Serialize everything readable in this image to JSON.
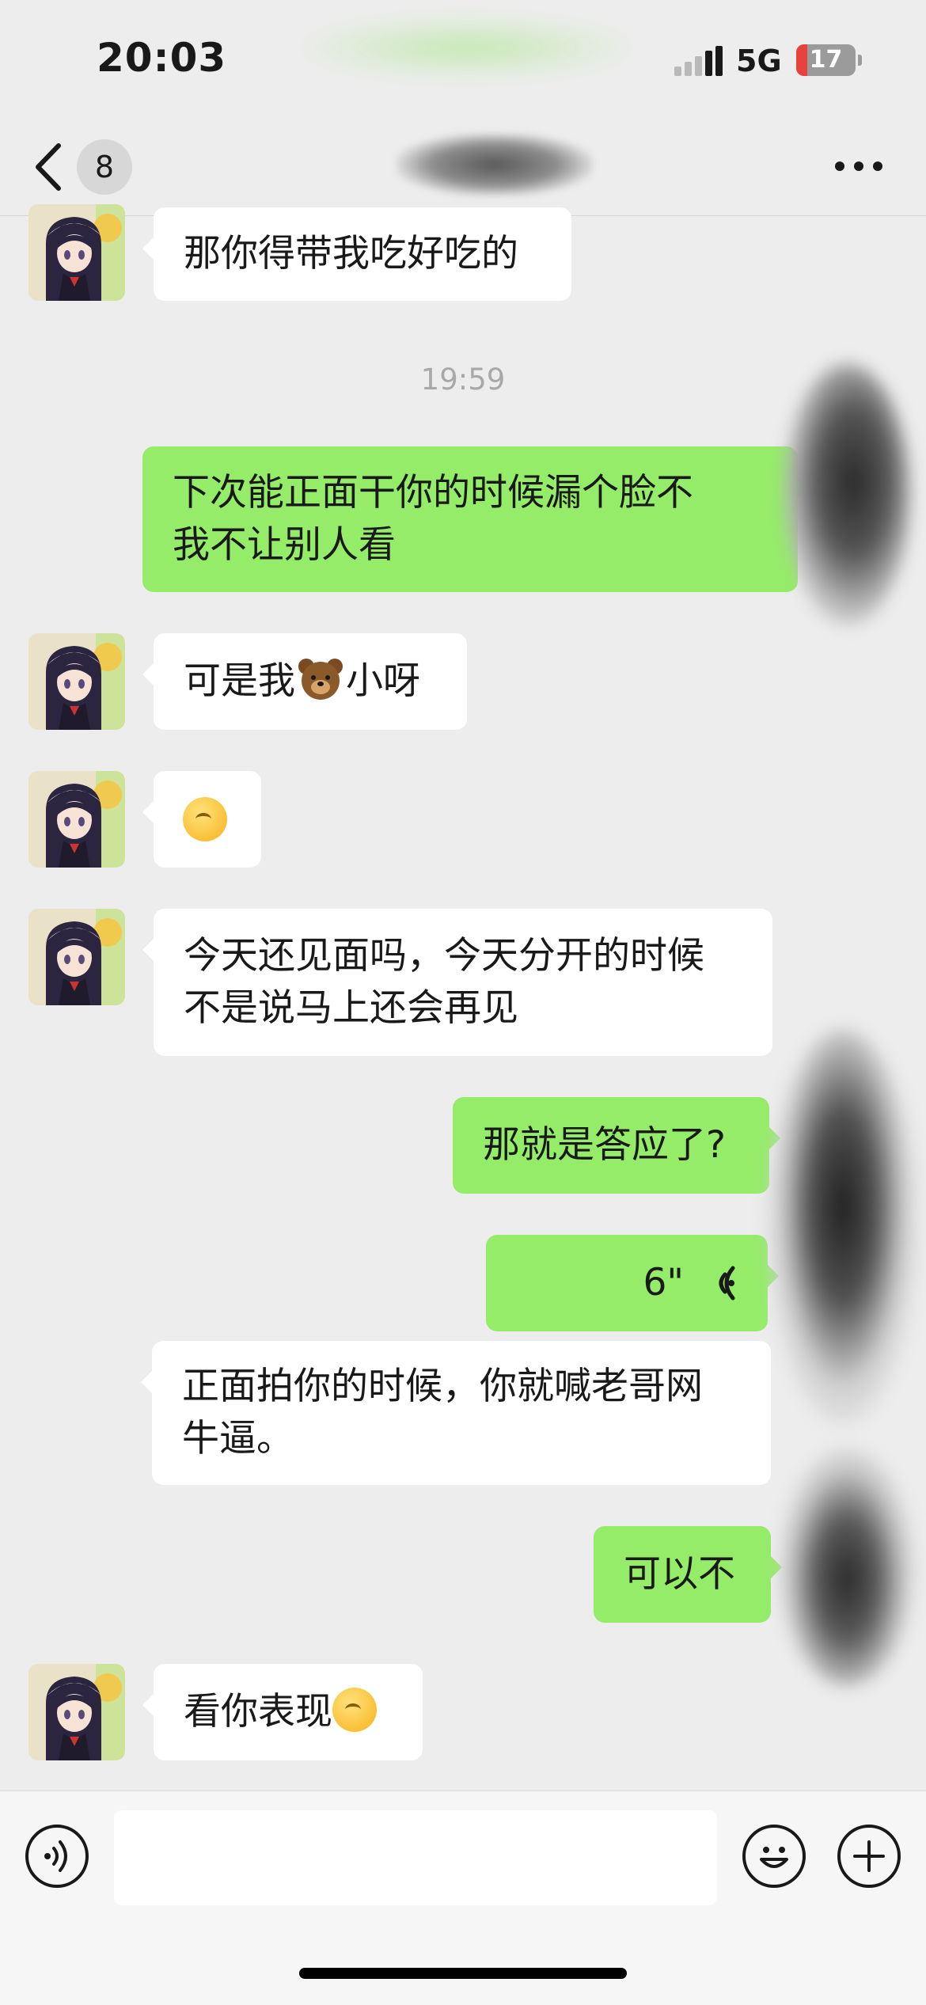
{
  "status_bar": {
    "time": "20:03",
    "network": "5G",
    "battery": "17"
  },
  "header": {
    "unread_count": "8"
  },
  "messages": [
    {
      "side": "left",
      "lines": [
        "那你得带我吃好吃的"
      ]
    },
    {
      "timestamp": "19:59"
    },
    {
      "side": "right",
      "lines": [
        "下次能正面干你的时候漏个脸不",
        "我不让别人看"
      ]
    },
    {
      "side": "left",
      "text_before": "可是我",
      "emoji": "bear-emoji",
      "text_after": "小呀"
    },
    {
      "side": "left",
      "emoji_only": "smirk-emoji"
    },
    {
      "side": "left",
      "lines": [
        "今天还见面吗，今天分开的时候",
        "不是说马上还会再见"
      ]
    },
    {
      "side": "right",
      "lines": [
        "那就是答应了?"
      ]
    },
    {
      "side": "right",
      "voice_duration": "6\""
    },
    {
      "side": "left",
      "lines": [
        "正面拍你的时候，你就喊老哥网",
        "牛逼。"
      ]
    },
    {
      "side": "right",
      "lines": [
        "可以不"
      ]
    },
    {
      "side": "left",
      "text_before": "看你表现",
      "emoji": "smirk-emoji"
    }
  ],
  "colors": {
    "sent_bubble": "#95ec69",
    "received_bubble": "#ffffff",
    "background": "#ededed"
  },
  "input_bar": {
    "text": ""
  }
}
